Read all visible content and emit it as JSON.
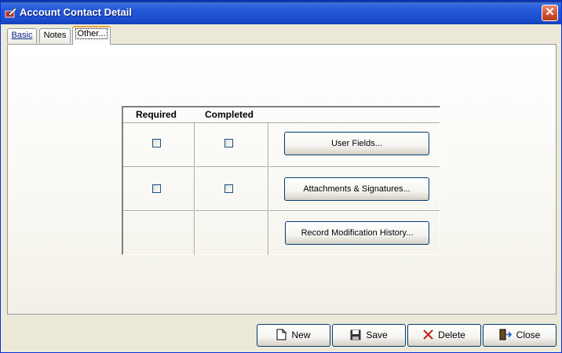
{
  "window": {
    "title": "Account Contact Detail",
    "title_icon": "edit-icon",
    "close_glyph": "✕"
  },
  "tabs": [
    {
      "label": "Basic"
    },
    {
      "label": "Notes"
    },
    {
      "label": "Other..."
    }
  ],
  "grid": {
    "headers": {
      "required": "Required",
      "completed": "Completed"
    },
    "rows": [
      {
        "button": "User Fields...",
        "has_checkboxes": true
      },
      {
        "button": "Attachments & Signatures...",
        "has_checkboxes": true
      },
      {
        "button": "Record Modification History...",
        "has_checkboxes": false
      }
    ]
  },
  "buttons": {
    "new": "New",
    "save": "Save",
    "delete": "Delete",
    "close": "Close"
  },
  "colors": {
    "titlebar": "#1c4fd0",
    "close_button": "#d24e2d",
    "tab_highlight": "#e8a33c"
  }
}
